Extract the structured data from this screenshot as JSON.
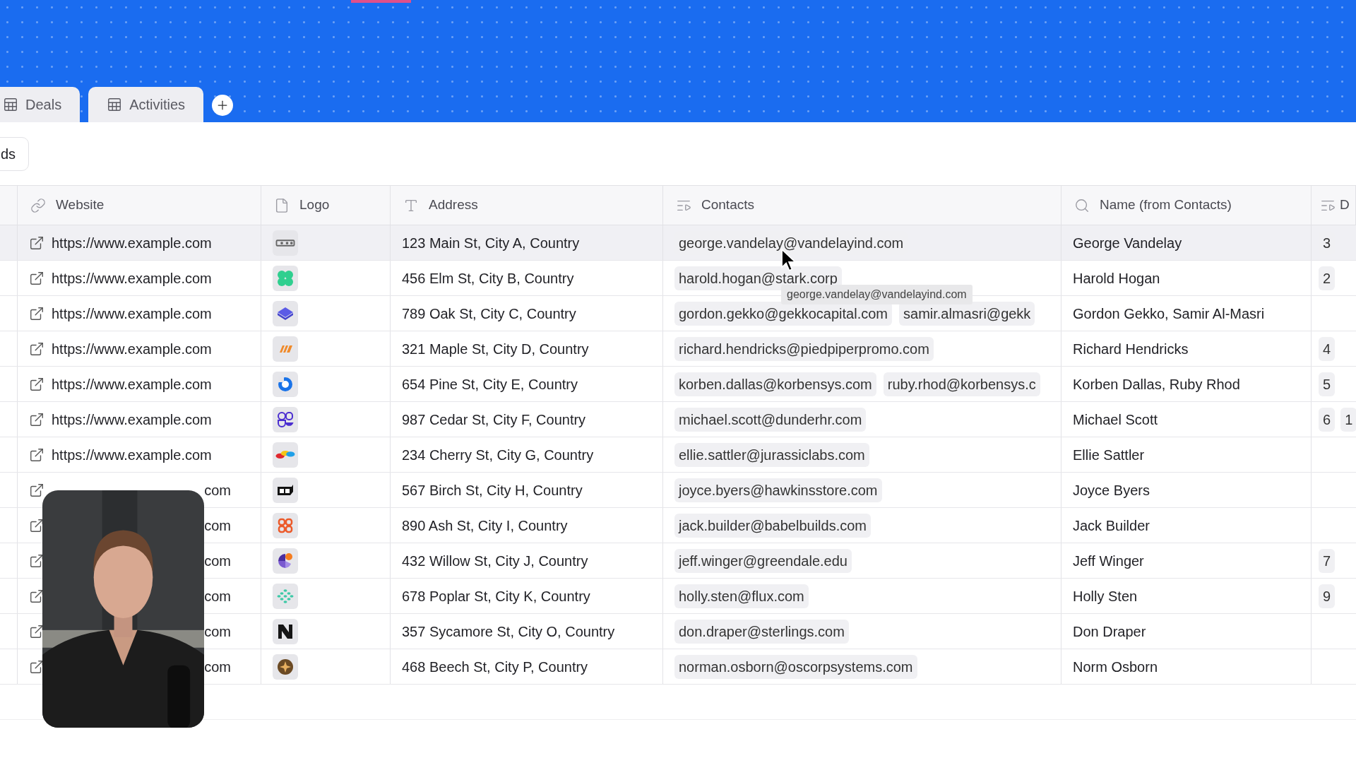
{
  "tabs": [
    {
      "label": "Deals",
      "selected": false
    },
    {
      "label": "Activities",
      "selected": false
    }
  ],
  "toolbar_button": {
    "label": "ds"
  },
  "columns": [
    {
      "label": "Website",
      "kind": "link"
    },
    {
      "label": "Logo",
      "kind": "file"
    },
    {
      "label": "Address",
      "kind": "text"
    },
    {
      "label": "Contacts",
      "kind": "linked"
    },
    {
      "label": "Name (from Contacts)",
      "kind": "lookup"
    },
    {
      "label": "D",
      "kind": "linked"
    }
  ],
  "rows": [
    {
      "website": "https://www.example.com",
      "covered": false,
      "highlighted": true,
      "address": "123 Main St, City A, Country",
      "contacts": [
        "george.vandelay@vandelayind.com"
      ],
      "name": "George Vandelay",
      "numbers": [
        "3"
      ]
    },
    {
      "website": "https://www.example.com",
      "covered": false,
      "highlighted": false,
      "address": "456 Elm St, City B, Country",
      "contacts": [
        "harold.hogan@stark.corp"
      ],
      "name": "Harold Hogan",
      "numbers": [
        "2"
      ]
    },
    {
      "website": "https://www.example.com",
      "covered": false,
      "highlighted": false,
      "address": "789 Oak St, City C, Country",
      "contacts": [
        "gordon.gekko@gekkocapital.com",
        "samir.almasri@gekk"
      ],
      "name": "Gordon Gekko, Samir Al-Masri",
      "numbers": []
    },
    {
      "website": "https://www.example.com",
      "covered": false,
      "highlighted": false,
      "address": "321 Maple St, City D, Country",
      "contacts": [
        "richard.hendricks@piedpiperpromo.com"
      ],
      "name": "Richard Hendricks",
      "numbers": [
        "4"
      ]
    },
    {
      "website": "https://www.example.com",
      "covered": false,
      "highlighted": false,
      "address": "654 Pine St, City E, Country",
      "contacts": [
        "korben.dallas@korbensys.com",
        "ruby.rhod@korbensys.c"
      ],
      "name": "Korben Dallas, Ruby Rhod",
      "numbers": [
        "5"
      ]
    },
    {
      "website": "https://www.example.com",
      "covered": false,
      "highlighted": false,
      "address": "987 Cedar St, City F, Country",
      "contacts": [
        "michael.scott@dunderhr.com"
      ],
      "name": "Michael Scott",
      "numbers": [
        "6",
        "1"
      ]
    },
    {
      "website": "https://www.example.com",
      "covered": false,
      "highlighted": false,
      "address": "234 Cherry St, City G, Country",
      "contacts": [
        "ellie.sattler@jurassiclabs.com"
      ],
      "name": "Ellie Sattler",
      "numbers": []
    },
    {
      "website": "com",
      "covered": true,
      "highlighted": false,
      "address": "567 Birch St, City H, Country",
      "contacts": [
        "joyce.byers@hawkinsstore.com"
      ],
      "name": "Joyce Byers",
      "numbers": []
    },
    {
      "website": "com",
      "covered": true,
      "highlighted": false,
      "address": "890 Ash St, City I, Country",
      "contacts": [
        "jack.builder@babelbuilds.com"
      ],
      "name": "Jack Builder",
      "numbers": []
    },
    {
      "website": "com",
      "covered": true,
      "highlighted": false,
      "address": "432 Willow St, City J, Country",
      "contacts": [
        "jeff.winger@greendale.edu"
      ],
      "name": "Jeff Winger",
      "numbers": [
        "7"
      ]
    },
    {
      "website": "com",
      "covered": true,
      "highlighted": false,
      "address": "678 Poplar St, City K, Country",
      "contacts": [
        "holly.sten@flux.com"
      ],
      "name": "Holly Sten",
      "numbers": [
        "9"
      ]
    },
    {
      "website": "com",
      "covered": true,
      "highlighted": false,
      "address": "357 Sycamore St, City O, Country",
      "contacts": [
        "don.draper@sterlings.com"
      ],
      "name": "Don Draper",
      "numbers": []
    },
    {
      "website": "com",
      "covered": true,
      "highlighted": false,
      "address": "468 Beech St, City P, Country",
      "contacts": [
        "norman.osborn@oscorpsystems.com"
      ],
      "name": "Norm Osborn",
      "numbers": []
    }
  ],
  "tooltip": {
    "text": "george.vandelay@vandelayind.com"
  }
}
